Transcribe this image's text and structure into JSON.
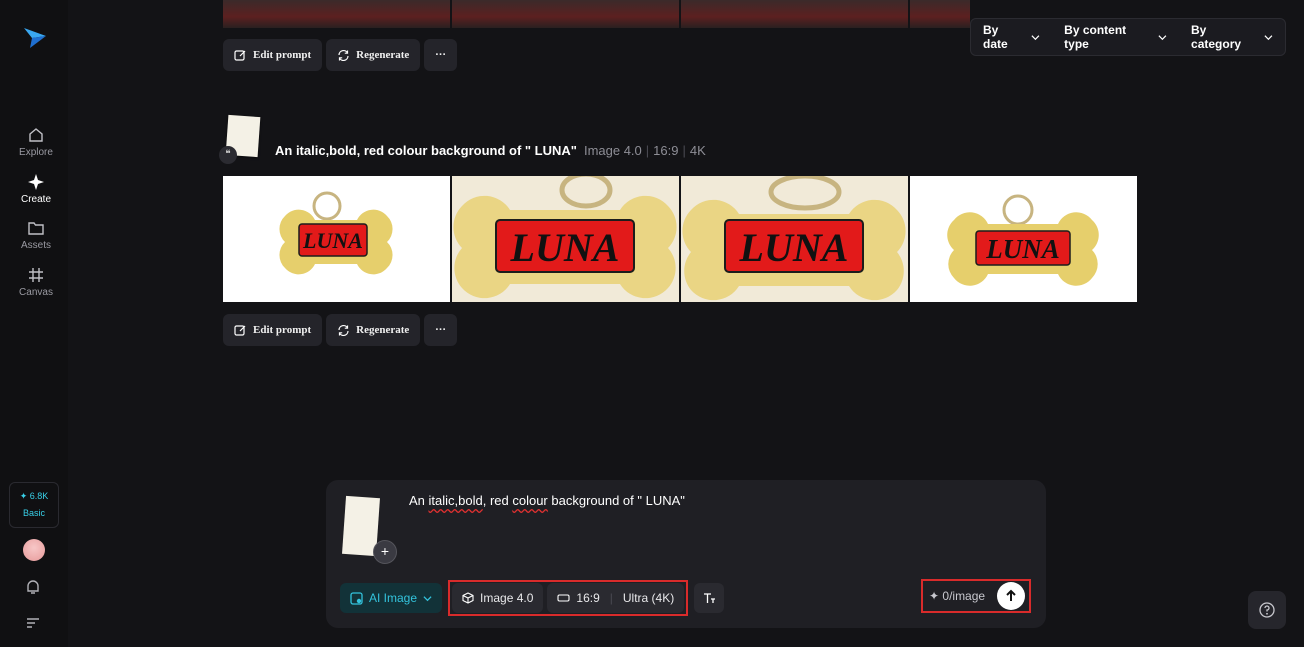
{
  "sidebar": {
    "nav": [
      {
        "label": "Explore",
        "icon": "home-icon"
      },
      {
        "label": "Create",
        "icon": "sparkle-icon",
        "active": true
      },
      {
        "label": "Assets",
        "icon": "folder-icon"
      },
      {
        "label": "Canvas",
        "icon": "hash-grid-icon"
      }
    ],
    "credits": {
      "amount": "✦ 6.8K",
      "plan": "Basic"
    }
  },
  "filters": [
    {
      "label": "By date"
    },
    {
      "label": "By content type"
    },
    {
      "label": "By category"
    }
  ],
  "actions": {
    "edit_prompt": "Edit prompt",
    "regenerate": "Regenerate",
    "more": "···"
  },
  "generation": {
    "prompt": "An italic,bold, red colour background of \" LUNA\"",
    "model": "Image 4.0",
    "ratio": "16:9",
    "resolution": "4K",
    "image_text": "LUNA"
  },
  "composer": {
    "prompt_parts": [
      "An ",
      "italic,bold",
      ", red ",
      "colour",
      " background of \" LUNA\""
    ],
    "mode": "AI Image",
    "model": "Image 4.0",
    "ratio": "16:9",
    "quality": "Ultra (4K)",
    "cost": "0/image",
    "plus": "+",
    "quote_glyph": "❝"
  },
  "colors": {
    "accent": "#33c3dc",
    "highlight_border": "#d92b2b"
  }
}
